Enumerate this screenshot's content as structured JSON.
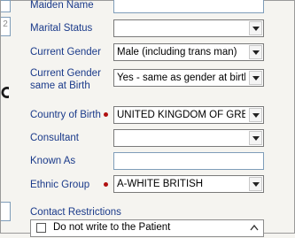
{
  "fields": {
    "maiden_name": {
      "label": "Maiden Name",
      "value": ""
    },
    "marital_status": {
      "label": "Marital Status",
      "value": ""
    },
    "current_gender": {
      "label": "Current Gender",
      "value": "Male (including trans man)"
    },
    "gender_same_at_birth": {
      "label_line1": "Current Gender",
      "label_line2": "same at Birth",
      "value": "Yes - same as gender at birth"
    },
    "country_of_birth": {
      "label": "Country of Birth",
      "value": "UNITED KINGDOM OF GREAT BRITAIN"
    },
    "consultant": {
      "label": "Consultant",
      "value": ""
    },
    "known_as": {
      "label": "Known As",
      "value": ""
    },
    "ethnic_group": {
      "label": "Ethnic Group",
      "value": "A-WHITE BRITISH"
    }
  },
  "contact_restrictions": {
    "label": "Contact Restrictions",
    "options": [
      {
        "label": "Do not write to the Patient",
        "checked": false
      }
    ]
  },
  "left_gutter": {
    "number_text": "2"
  },
  "icons": {
    "dropdown": "chevron-down-icon",
    "required": "required-dot-icon",
    "scroll_up": "scroll-up-icon",
    "help": "help-icon"
  },
  "colors": {
    "label": "#1a3a8a",
    "required": "#b01010",
    "field_border": "#7f9db9",
    "background": "#f5f4f0"
  }
}
